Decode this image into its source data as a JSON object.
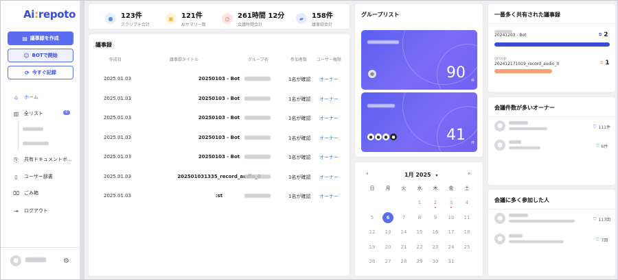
{
  "app": {
    "logo_ai": "Ai",
    "logo_colon": ":",
    "logo_rest": "repoto"
  },
  "sidebar": {
    "create_label": "議事録を作成",
    "bot_label": "BOTで開始",
    "record_label": "今すぐ記録",
    "nav": [
      {
        "label": "ホーム",
        "icon": "home-icon"
      },
      {
        "label": "全リスト",
        "icon": "document-list-icon",
        "badge": "0"
      },
      {
        "label": "共有ドキュメントボ...",
        "icon": "shared-document-icon"
      },
      {
        "label": "ユーザー辞書",
        "icon": "book-icon"
      },
      {
        "label": "ごみ箱",
        "icon": "trash-icon"
      },
      {
        "label": "ログアウト",
        "icon": "logout-icon"
      }
    ]
  },
  "stats": [
    {
      "value": "123件",
      "label": "スクリプト合計",
      "icon": "script-icon",
      "color": "#5a8cf0",
      "bg": "#e6eefc"
    },
    {
      "value": "121件",
      "label": "AIサマリー数",
      "icon": "summary-icon",
      "color": "#f0b429",
      "bg": "#fdf3dc"
    },
    {
      "value": "261時間 12分",
      "label": "会議時間合計",
      "icon": "clock-icon",
      "color": "#ef6a5a",
      "bg": "#fde6e2"
    },
    {
      "value": "158件",
      "label": "議事録合計",
      "icon": "folder-icon",
      "color": "#6b7cf2",
      "bg": "#e8eafd"
    }
  ],
  "minutes": {
    "title": "議事録",
    "headers": [
      "作成日",
      "議事録タイトル",
      "グループ名",
      "参加者数",
      "ユーザー権限"
    ],
    "rows": [
      {
        "date": "2025.01.03",
        "title": "20250103 - Bot",
        "participants": "1名が確認",
        "role": "オーナー"
      },
      {
        "date": "2025.01.03",
        "title": "20250103 - Bot",
        "participants": "1名が確認",
        "role": "オーナー"
      },
      {
        "date": "2025.01.03",
        "title": "20250103 - Bot",
        "participants": "1名が確認",
        "role": "オーナー"
      },
      {
        "date": "2025.01.03",
        "title": "20250103 - Bot",
        "participants": "1名が確認",
        "role": "オーナー"
      },
      {
        "date": "2025.01.03",
        "title": "20250103 - Bot",
        "participants": "1名が確認",
        "role": "オーナー"
      },
      {
        "date": "2025.01.03",
        "title": "202501031335_record_audio_0",
        "participants": "1名が確認",
        "role": "オーナー"
      },
      {
        "date": "2025.01.03",
        "title": ":st",
        "participants": "1名が確認",
        "role": "オーナー"
      }
    ]
  },
  "groups": {
    "title": "グループリスト",
    "cards": [
      {
        "count": "90",
        "unit": "件"
      },
      {
        "count": "41",
        "unit": "件"
      }
    ]
  },
  "calendar": {
    "month": "1月 2025",
    "dow": [
      "日",
      "月",
      "火",
      "水",
      "木",
      "金",
      "土"
    ],
    "weeks": [
      [
        "",
        "",
        "",
        "1",
        "2",
        "3",
        "4"
      ],
      [
        "5",
        "6",
        "7",
        "8",
        "9",
        "10",
        "11"
      ],
      [
        "12",
        "13",
        "14",
        "15",
        "16",
        "17",
        "18"
      ],
      [
        "19",
        "20",
        "21",
        "22",
        "23",
        "24",
        "25"
      ],
      [
        "26",
        "27",
        "28",
        "29",
        "30",
        "31",
        ""
      ]
    ],
    "today": "6",
    "dots": [
      "2",
      "3"
    ]
  },
  "shared": {
    "title": "一番多く共有された議事録",
    "items": [
      {
        "name": "20241203 - Bot",
        "count": "2",
        "color": "#3a4bd8",
        "fill": 1.0
      },
      {
        "group": "group",
        "name": "202412171019_record_audio_0",
        "count": "1",
        "color": "#f7a078",
        "fill": 0.5
      }
    ]
  },
  "owners": {
    "title": "会議件数が多いオーナー",
    "items": [
      {
        "count": "111件",
        "color": "#6b7cf2"
      },
      {
        "count": "6件",
        "color": "#2bc0c0"
      }
    ]
  },
  "participants": {
    "title": "会議に多く参加した人",
    "items": [
      {
        "count": "117回",
        "color": "#6b7cf2"
      },
      {
        "count": "7回",
        "color": "#2bc0c0"
      }
    ]
  }
}
